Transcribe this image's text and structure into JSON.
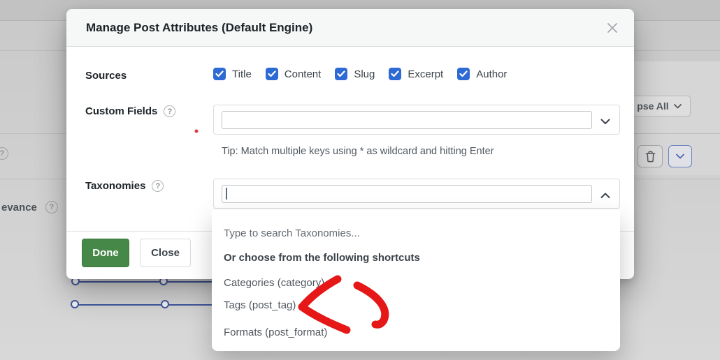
{
  "colors": {
    "accent_blue": "#2e6ad3",
    "button_green": "#468847",
    "annotation_red": "#e51717",
    "slider_blue": "#41589e"
  },
  "modal": {
    "title": "Manage Post Attributes (Default Engine)",
    "sources": {
      "label": "Sources",
      "options": [
        {
          "label": "Title",
          "checked": true
        },
        {
          "label": "Content",
          "checked": true
        },
        {
          "label": "Slug",
          "checked": true
        },
        {
          "label": "Excerpt",
          "checked": true
        },
        {
          "label": "Author",
          "checked": true
        }
      ]
    },
    "custom_fields": {
      "label": "Custom Fields",
      "help_icon": "?",
      "input_value": "",
      "tip": "Tip: Match multiple keys using * as wildcard and hitting Enter"
    },
    "taxonomies": {
      "label": "Taxonomies",
      "help_icon": "?",
      "input_value": "",
      "dropdown": {
        "hint": "Type to search Taxonomies...",
        "heading": "Or choose from the following shortcuts",
        "options": [
          {
            "label": "Categories (category)"
          },
          {
            "label": "Tags (post_tag)"
          },
          {
            "label": "Formats (post_format)"
          }
        ]
      }
    },
    "footer": {
      "done_label": "Done",
      "close_label": "Close"
    }
  },
  "background": {
    "collapse_all_button": "pse All",
    "relevance_label": "evance",
    "help_icon": "?"
  }
}
